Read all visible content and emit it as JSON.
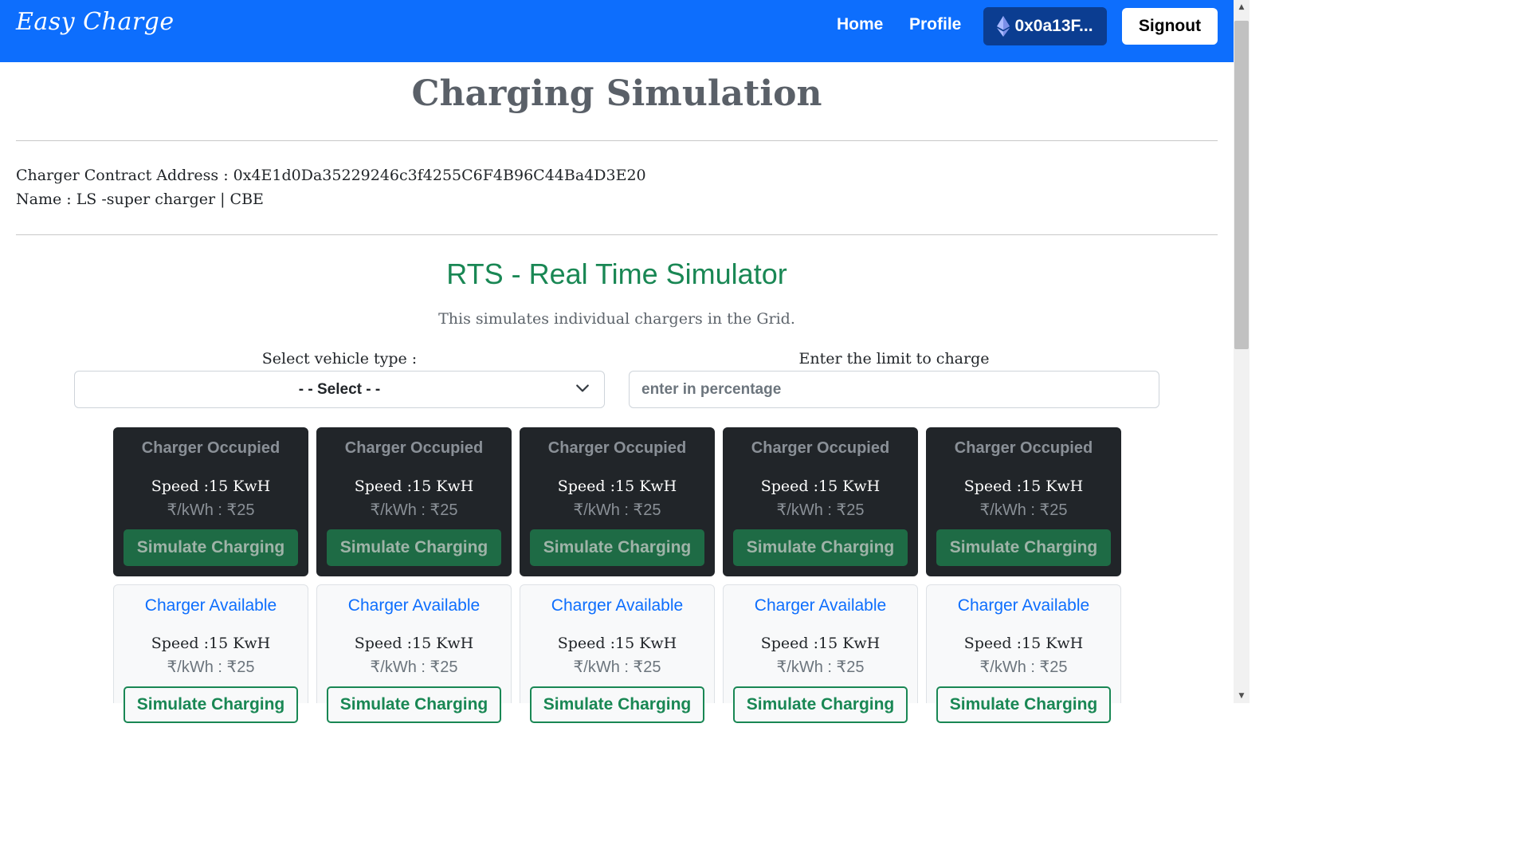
{
  "navbar": {
    "brand": "Easy Charge",
    "home": "Home",
    "profile": "Profile",
    "wallet": "0x0a13F...",
    "signout": "Signout",
    "colors": {
      "navbar": "#0d6efd",
      "wallet_bg": "#0b3d91"
    }
  },
  "page": {
    "title": "Charging Simulation",
    "contract_line": "Charger Contract Address : 0x4E1d0Da35229246c3f4255C6F4B96C44Ba4D3E20",
    "name_line": "Name : LS -super charger | CBE"
  },
  "rts": {
    "title": "RTS - Real Time Simulator",
    "subtitle": "This simulates individual chargers in the Grid.",
    "vehicle_label": "Select vehicle type :",
    "vehicle_selected": "- - Select - -",
    "limit_label": "Enter the limit to charge",
    "limit_placeholder": "enter in percentage",
    "colors": {
      "title": "#198754"
    }
  },
  "chargers_occupied": [
    {
      "status": "Charger Occupied",
      "speed": "Speed :15 KwH",
      "price": "₹/kWh : ₹25",
      "button": "Simulate Charging"
    },
    {
      "status": "Charger Occupied",
      "speed": "Speed :15 KwH",
      "price": "₹/kWh : ₹25",
      "button": "Simulate Charging"
    },
    {
      "status": "Charger Occupied",
      "speed": "Speed :15 KwH",
      "price": "₹/kWh : ₹25",
      "button": "Simulate Charging"
    },
    {
      "status": "Charger Occupied",
      "speed": "Speed :15 KwH",
      "price": "₹/kWh : ₹25",
      "button": "Simulate Charging"
    },
    {
      "status": "Charger Occupied",
      "speed": "Speed :15 KwH",
      "price": "₹/kWh : ₹25",
      "button": "Simulate Charging"
    }
  ],
  "chargers_available": [
    {
      "status": "Charger Available",
      "speed": "Speed :15 KwH",
      "price": "₹/kWh : ₹25",
      "button": "Simulate Charging"
    },
    {
      "status": "Charger Available",
      "speed": "Speed :15 KwH",
      "price": "₹/kWh : ₹25",
      "button": "Simulate Charging"
    },
    {
      "status": "Charger Available",
      "speed": "Speed :15 KwH",
      "price": "₹/kWh : ₹25",
      "button": "Simulate Charging"
    },
    {
      "status": "Charger Available",
      "speed": "Speed :15 KwH",
      "price": "₹/kWh : ₹25",
      "button": "Simulate Charging"
    },
    {
      "status": "Charger Available",
      "speed": "Speed :15 KwH",
      "price": "₹/kWh : ₹25",
      "button": "Simulate Charging"
    }
  ]
}
